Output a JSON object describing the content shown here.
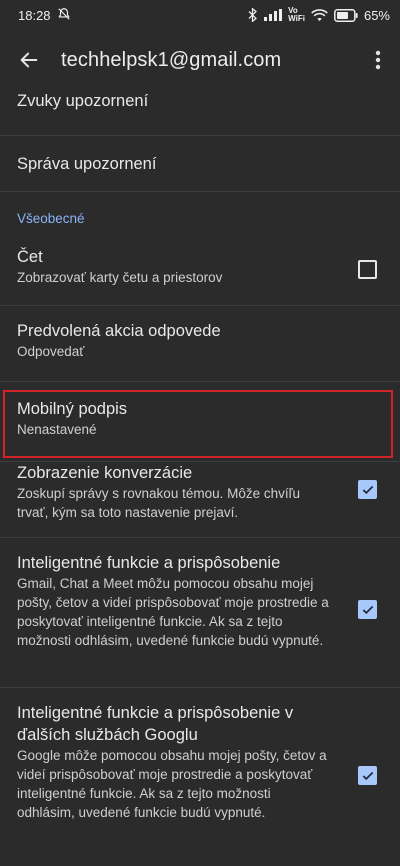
{
  "status_bar": {
    "time": "18:28",
    "vowifi_top": "Vo",
    "vowifi_bottom": "WiFi",
    "battery": "65%",
    "icons": [
      "mute-icon",
      "bluetooth-icon",
      "signal-icon",
      "vowifi-icon",
      "wifi-icon",
      "battery-icon"
    ]
  },
  "app_bar": {
    "title": "techhelpsk1@gmail.com",
    "back_icon": "arrow-left-icon",
    "menu_icon": "more-vertical-icon"
  },
  "settings": {
    "item_sounds": "Zvuky upozornení",
    "item_manage": "Správa upozornení",
    "section_general": "Všeobecné",
    "chat": {
      "title": "Čet",
      "subtitle": "Zobrazovať karty četu a priestorov",
      "checked": false
    },
    "default_reply": {
      "title": "Predvolená akcia odpovede",
      "subtitle": "Odpovedať"
    },
    "mobile_signature": {
      "title": "Mobilný podpis",
      "subtitle": "Nenastavené"
    },
    "conversation_view": {
      "title": "Zobrazenie konverzácie",
      "subtitle": "Zoskupí správy s rovnakou témou. Môže chvíľu trvať, kým sa toto nastavenie prejaví.",
      "checked": true
    },
    "smart_features": {
      "title": "Inteligentné funkcie a prispôsobenie",
      "subtitle": "Gmail, Chat a Meet môžu pomocou obsahu mojej pošty, četov a videí prispôsobovať moje prostredie a poskytovať inteligentné funkcie. Ak sa z tejto možnosti odhlásim, uvedené funkcie budú vypnuté.",
      "checked": true
    },
    "smart_features_other": {
      "title": "Inteligentné funkcie a prispôsobenie v ďalších službách Googlu",
      "subtitle": "Google môže pomocou obsahu mojej pošty, četov a videí prispôsobovať moje prostredie a poskytovať inteligentné funkcie. Ak sa z tejto možnosti odhlásim, uvedené funkcie budú vypnuté.",
      "checked": true
    }
  },
  "colors": {
    "background": "#2b2b2b",
    "accent": "#8ab4f8",
    "checkbox_on": "#a8c7fa",
    "highlight_border": "#d0242a"
  }
}
